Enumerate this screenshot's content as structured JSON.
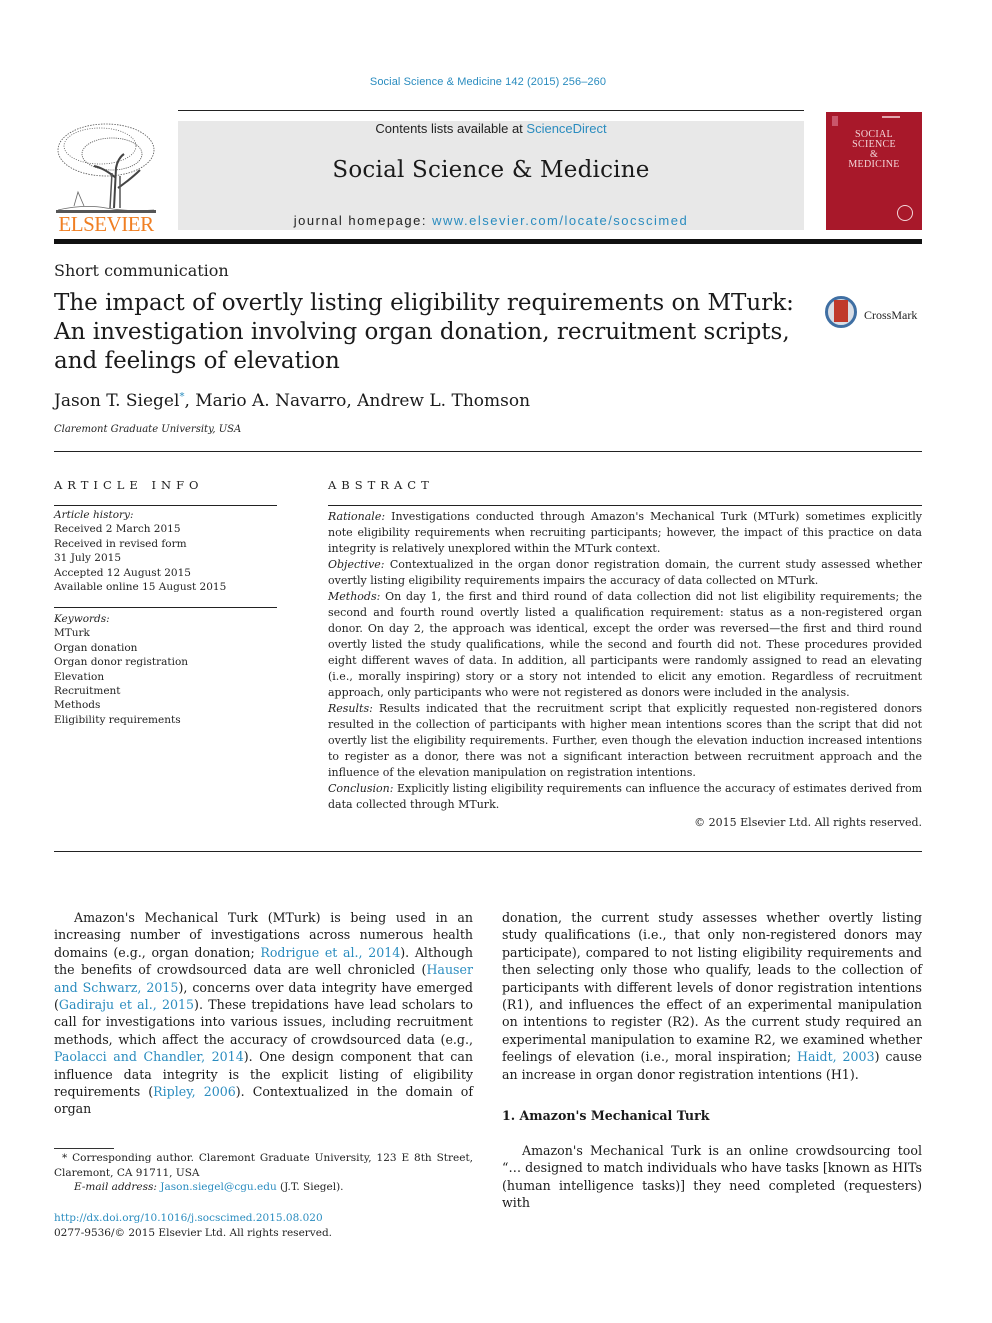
{
  "header": {
    "citation": "Social Science & Medicine 142 (2015) 256–260",
    "contents_prefix": "Contents lists available at ",
    "contents_link": "ScienceDirect",
    "journal_name": "Social Science & Medicine",
    "homepage_prefix": "journal homepage: ",
    "homepage_link": "www.elsevier.com/locate/socscimed",
    "publisher_logo_text": "ELSEVIER",
    "cover_title_lines": [
      "SOCIAL",
      "SCIENCE",
      "&",
      "MEDICINE"
    ],
    "colors": {
      "link": "#2a8cbf",
      "elsevier_orange": "#f07f23",
      "cover_red": "#a8182a",
      "masthead_gray": "#e8e8e8"
    }
  },
  "article": {
    "type": "Short communication",
    "title": "The impact of overtly listing eligibility requirements on MTurk: An investigation involving organ donation, recruitment scripts, and feelings of elevation",
    "crossmark_label": "CrossMark",
    "authors": [
      {
        "name": "Jason T. Siegel",
        "mark": "*"
      },
      {
        "name": "Mario A. Navarro",
        "mark": ""
      },
      {
        "name": "Andrew L. Thomson",
        "mark": ""
      }
    ],
    "affiliation": "Claremont Graduate University, USA"
  },
  "article_info": {
    "heading": "ARTICLE INFO",
    "history_label": "Article history:",
    "history": [
      "Received 2 March 2015",
      "Received in revised form",
      "31 July 2015",
      "Accepted 12 August 2015",
      "Available online 15 August 2015"
    ],
    "keywords_label": "Keywords:",
    "keywords": [
      "MTurk",
      "Organ donation",
      "Organ donor registration",
      "Elevation",
      "Recruitment",
      "Methods",
      "Eligibility requirements"
    ]
  },
  "abstract": {
    "heading": "ABSTRACT",
    "sections": [
      {
        "label": "Rationale:",
        "text": " Investigations conducted through Amazon's Mechanical Turk (MTurk) sometimes explicitly note eligibility requirements when recruiting participants; however, the impact of this practice on data integrity is relatively unexplored within the MTurk context."
      },
      {
        "label": "Objective:",
        "text": " Contextualized in the organ donor registration domain, the current study assessed whether overtly listing eligibility requirements impairs the accuracy of data collected on MTurk."
      },
      {
        "label": "Methods:",
        "text": " On day 1, the first and third round of data collection did not list eligibility requirements; the second and fourth round overtly listed a qualification requirement: status as a non-registered organ donor. On day 2, the approach was identical, except the order was reversed—the first and third round overtly listed the study qualifications, while the second and fourth did not. These procedures provided eight different waves of data. In addition, all participants were randomly assigned to read an elevating (i.e., morally inspiring) story or a story not intended to elicit any emotion. Regardless of recruitment approach, only participants who were not registered as donors were included in the analysis."
      },
      {
        "label": "Results:",
        "text": " Results indicated that the recruitment script that explicitly requested non-registered donors resulted in the collection of participants with higher mean intentions scores than the script that did not overtly list the eligibility requirements. Further, even though the elevation induction increased intentions to register as a donor, there was not a significant interaction between recruitment approach and the influence of the elevation manipulation on registration intentions."
      },
      {
        "label": "Conclusion:",
        "text": " Explicitly listing eligibility requirements can influence the accuracy of estimates derived from data collected through MTurk."
      }
    ],
    "copyright": "© 2015 Elsevier Ltd. All rights reserved."
  },
  "body": {
    "intro_left": [
      {
        "t": "Amazon's Mechanical Turk (MTurk) is being used in an increasing number of investigations across numerous health domains (e.g., organ donation; "
      },
      {
        "link": "Rodrigue et al., 2014"
      },
      {
        "t": "). Although the benefits of crowdsourced data are well chronicled ("
      },
      {
        "link": "Hauser and Schwarz, 2015"
      },
      {
        "t": "), concerns over data integrity have emerged ("
      },
      {
        "link": "Gadiraju et al., 2015"
      },
      {
        "t": "). These trepidations have lead scholars to call for investigations into various issues, including recruitment methods, which affect the accuracy of crowdsourced data (e.g., "
      },
      {
        "link": "Paolacci and Chandler, 2014"
      },
      {
        "t": "). One design component that can influence data integrity is the explicit listing of eligibility requirements ("
      },
      {
        "link": "Ripley, 2006"
      },
      {
        "t": "). Contextualized in the domain of organ"
      }
    ],
    "intro_right": [
      {
        "t": "donation, the current study assesses whether overtly listing study qualifications (i.e., that only non-registered donors may participate), compared to not listing eligibility requirements and then selecting only those who qualify, leads to the collection of participants with different levels of donor registration intentions (R1), and influences the effect of an experimental manipulation on intentions to register (R2). As the current study required an experimental manipulation to examine R2, we examined whether feelings of elevation (i.e., moral inspiration; "
      },
      {
        "link": "Haidt, 2003"
      },
      {
        "t": ") cause an increase in organ donor registration intentions (H1)."
      }
    ],
    "section_1_heading": "1.  Amazon's Mechanical Turk",
    "section_1_text": "Amazon's Mechanical Turk is an online crowdsourcing tool “… designed to match individuals who have tasks [known as HITs (human intelligence tasks)] they need completed (requesters) with"
  },
  "footnote": {
    "corresponding": "* Corresponding author. Claremont Graduate University, 123 E 8th Street, Claremont, CA 91711, USA",
    "email_label": "E-mail address: ",
    "email": "Jason.siegel@cgu.edu",
    "email_suffix": " (J.T. Siegel).",
    "doi": "http://dx.doi.org/10.1016/j.socscimed.2015.08.020",
    "issn_line": "0277-9536/© 2015 Elsevier Ltd. All rights reserved."
  }
}
